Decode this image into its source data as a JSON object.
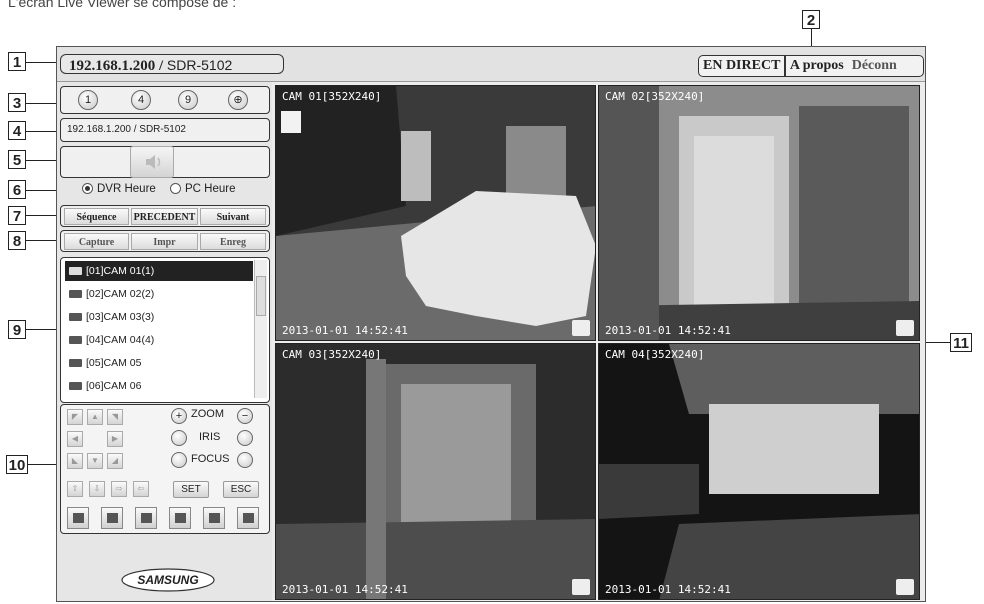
{
  "intro": "L'écran Live Viewer se compose de :",
  "callouts": [
    "1",
    "2",
    "3",
    "4",
    "5",
    "6",
    "7",
    "8",
    "9",
    "10",
    "11"
  ],
  "header": {
    "host_bold": "192.168.1.200",
    "host_sep": " / ",
    "model": "SDR-5102",
    "nav": {
      "live": "EN DIRECT",
      "about": "A propos",
      "logout": "Déconn"
    }
  },
  "split_buttons": [
    "1",
    "4",
    "9",
    "⊕"
  ],
  "device_label": "192.168.1.200 / SDR-5102",
  "time_source": {
    "dvr": "DVR Heure",
    "pc": "PC Heure",
    "selected": "dvr"
  },
  "sequence_buttons": [
    "Séquence",
    "PRECEDENT",
    "Suivant"
  ],
  "action_buttons": [
    "Capture",
    "Impr",
    "Enreg"
  ],
  "camera_list": [
    {
      "label": "[01]CAM 01(1)",
      "selected": true
    },
    {
      "label": "[02]CAM 02(2)",
      "selected": false
    },
    {
      "label": "[03]CAM 03(3)",
      "selected": false
    },
    {
      "label": "[04]CAM 04(4)",
      "selected": false
    },
    {
      "label": "[05]CAM 05",
      "selected": false
    },
    {
      "label": "[06]CAM 06",
      "selected": false
    }
  ],
  "ptz": {
    "zoom": "ZOOM",
    "iris": "IRIS",
    "focus": "FOCUS",
    "set": "SET",
    "esc": "ESC"
  },
  "logo": "SAMSUNG",
  "videos": [
    {
      "label": "CAM 01[352X240]",
      "time": "2013-01-01  14:52:41"
    },
    {
      "label": "CAM 02[352X240]",
      "time": "2013-01-01  14:52:41"
    },
    {
      "label": "CAM 03[352X240]",
      "time": "2013-01-01  14:52:41"
    },
    {
      "label": "CAM 04[352X240]",
      "time": "2013-01-01  14:52:41"
    }
  ]
}
